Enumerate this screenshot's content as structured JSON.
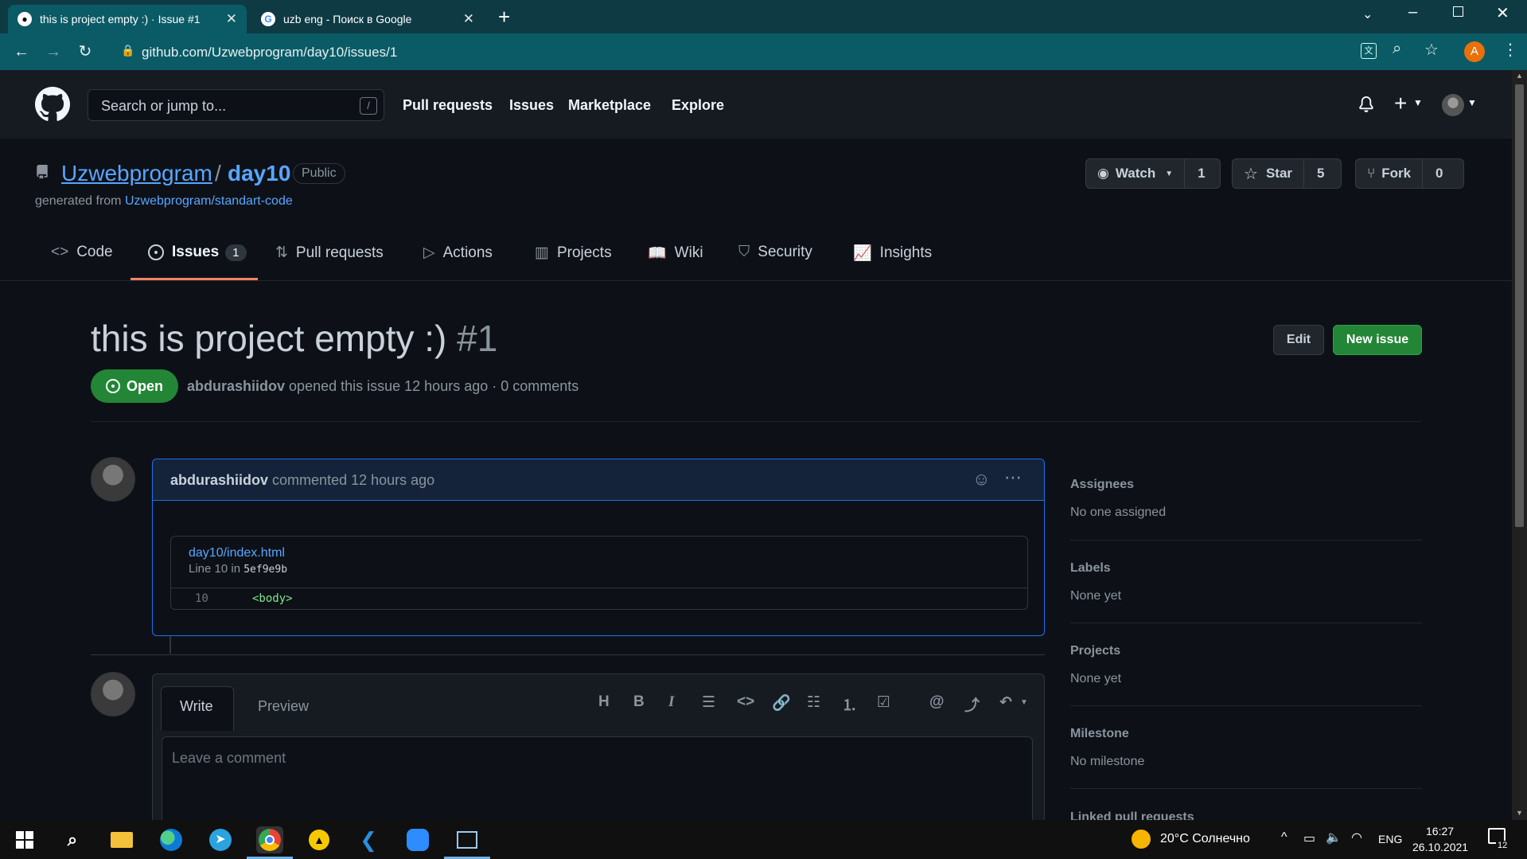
{
  "browser": {
    "tabs": [
      {
        "title": "this is project empty :) · Issue #1",
        "active": true
      },
      {
        "title": "uzb eng - Поиск в Google",
        "active": false
      }
    ],
    "url": "github.com/Uzwebprogram/day10/issues/1",
    "profile_letter": "A"
  },
  "header": {
    "search_placeholder": "Search or jump to...",
    "search_key": "/",
    "nav": [
      "Pull requests",
      "Issues",
      "Marketplace",
      "Explore"
    ]
  },
  "repo": {
    "owner": "Uzwebprogram",
    "separator": "/",
    "name": "day10",
    "visibility": "Public",
    "generated_prefix": "generated from",
    "generated_link": "Uzwebprogram/standart-code",
    "watch_label": "Watch",
    "watch_count": "1",
    "star_label": "Star",
    "star_count": "5",
    "fork_label": "Fork",
    "fork_count": "0",
    "tabs": {
      "code": "Code",
      "issues": "Issues",
      "issues_count": "1",
      "pulls": "Pull requests",
      "actions": "Actions",
      "projects": "Projects",
      "wiki": "Wiki",
      "security": "Security",
      "insights": "Insights"
    }
  },
  "issue": {
    "title": "this is project empty :)",
    "number": "#1",
    "edit_label": "Edit",
    "new_issue_label": "New issue",
    "state": "Open",
    "author": "abdurashiidov",
    "meta_rest": "opened this issue 12 hours ago · 0 comments"
  },
  "comment": {
    "author": "abdurashiidov",
    "action": "commented 12 hours ago",
    "file": "day10/index.html",
    "line_text": "Line 10 in",
    "sha": "5ef9e9b",
    "line_number": "10",
    "code": "<body>"
  },
  "editor": {
    "write_tab": "Write",
    "preview_tab": "Preview",
    "placeholder": "Leave a comment"
  },
  "sidebar": {
    "assignees_label": "Assignees",
    "assignees_value": "No one assigned",
    "labels_label": "Labels",
    "labels_value": "None yet",
    "projects_label": "Projects",
    "projects_value": "None yet",
    "milestone_label": "Milestone",
    "milestone_value": "No milestone",
    "linked_label": "Linked pull requests"
  },
  "taskbar": {
    "weather": "20°C  Солнечно",
    "lang": "ENG",
    "time": "16:27",
    "date": "26.10.2021",
    "notifications": "12"
  },
  "colors": {
    "accent": "#58a6ff",
    "green": "#238636",
    "background": "#0d1117",
    "header": "#161b22",
    "underline": "#f78166"
  }
}
